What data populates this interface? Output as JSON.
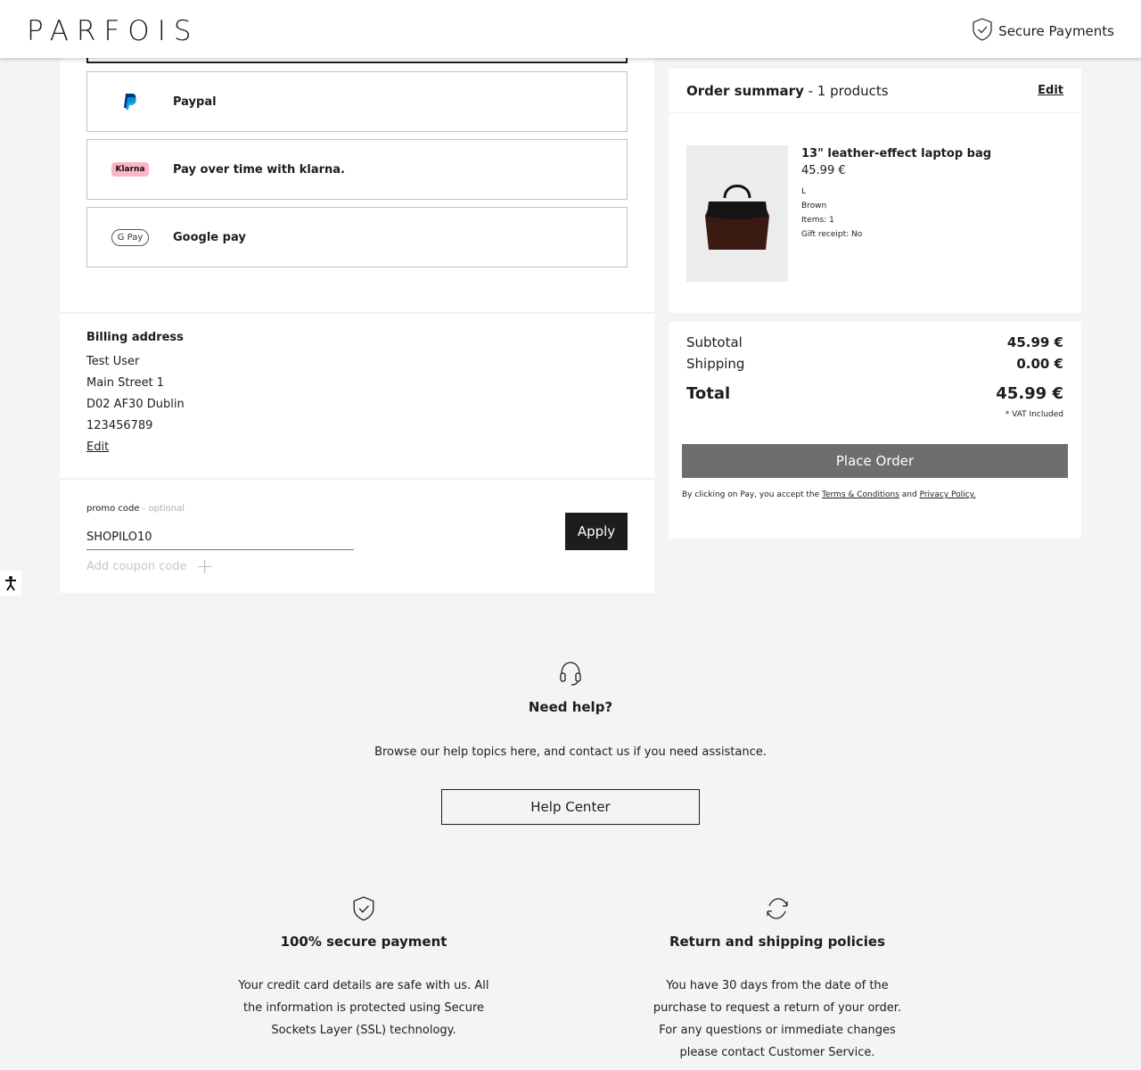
{
  "header": {
    "logo": "PARFOIS",
    "secure_payments": "Secure Payments"
  },
  "payment_methods": [
    {
      "label": "Paypal",
      "icon": "paypal-icon"
    },
    {
      "label": "Pay over time with klarna.",
      "icon": "klarna-icon",
      "badge": "Klarna"
    },
    {
      "label": "Google pay",
      "icon": "google-pay-icon",
      "badge": "G Pay"
    }
  ],
  "billing": {
    "title": "Billing address",
    "name": "Test User",
    "street": "Main Street 1",
    "city": "D02 AF30 Dublin",
    "phone": "123456789",
    "edit": "Edit"
  },
  "promo": {
    "label": "promo code",
    "optional": "- optional",
    "value": "SHOPILO10",
    "apply": "Apply",
    "add_coupon": "Add coupon code"
  },
  "summary": {
    "title": "Order summary",
    "count": "- 1 products",
    "edit": "Edit",
    "product": {
      "name": "13\" leather-effect laptop bag",
      "price": "45.99 €",
      "size": "L",
      "color": "Brown",
      "items": "Items: 1",
      "gift_receipt": "Gift receipt: No"
    }
  },
  "totals": {
    "subtotal_label": "Subtotal",
    "subtotal": "45.99 €",
    "shipping_label": "Shipping",
    "shipping": "0.00 €",
    "total_label": "Total",
    "total": "45.99 €",
    "vat": "* VAT Included",
    "place_order": "Place Order",
    "terms_prefix": "By clicking on Pay, you accept the",
    "terms_link": "Terms & Conditions",
    "and": "and",
    "privacy_link": "Privacy Policy."
  },
  "help": {
    "title": "Need help?",
    "text": "Browse our help topics here, and contact us if you need assistance.",
    "button": "Help Center"
  },
  "features": [
    {
      "title": "100% secure payment",
      "text": "Your credit card details are safe with us. All the information is protected using Secure Sockets Layer (SSL) technology."
    },
    {
      "title": "Return and shipping policies",
      "text": "You have 30 days from the date of the purchase to request a return of your order. For any questions or immediate changes please contact Customer Service."
    }
  ],
  "colors": {
    "dark": "#1d1d1d",
    "place_order_bg": "#6e6e6e",
    "page_bg": "#f4f4f4",
    "klarna_pink": "#ffb3c7",
    "paypal_blue": "#003087"
  }
}
